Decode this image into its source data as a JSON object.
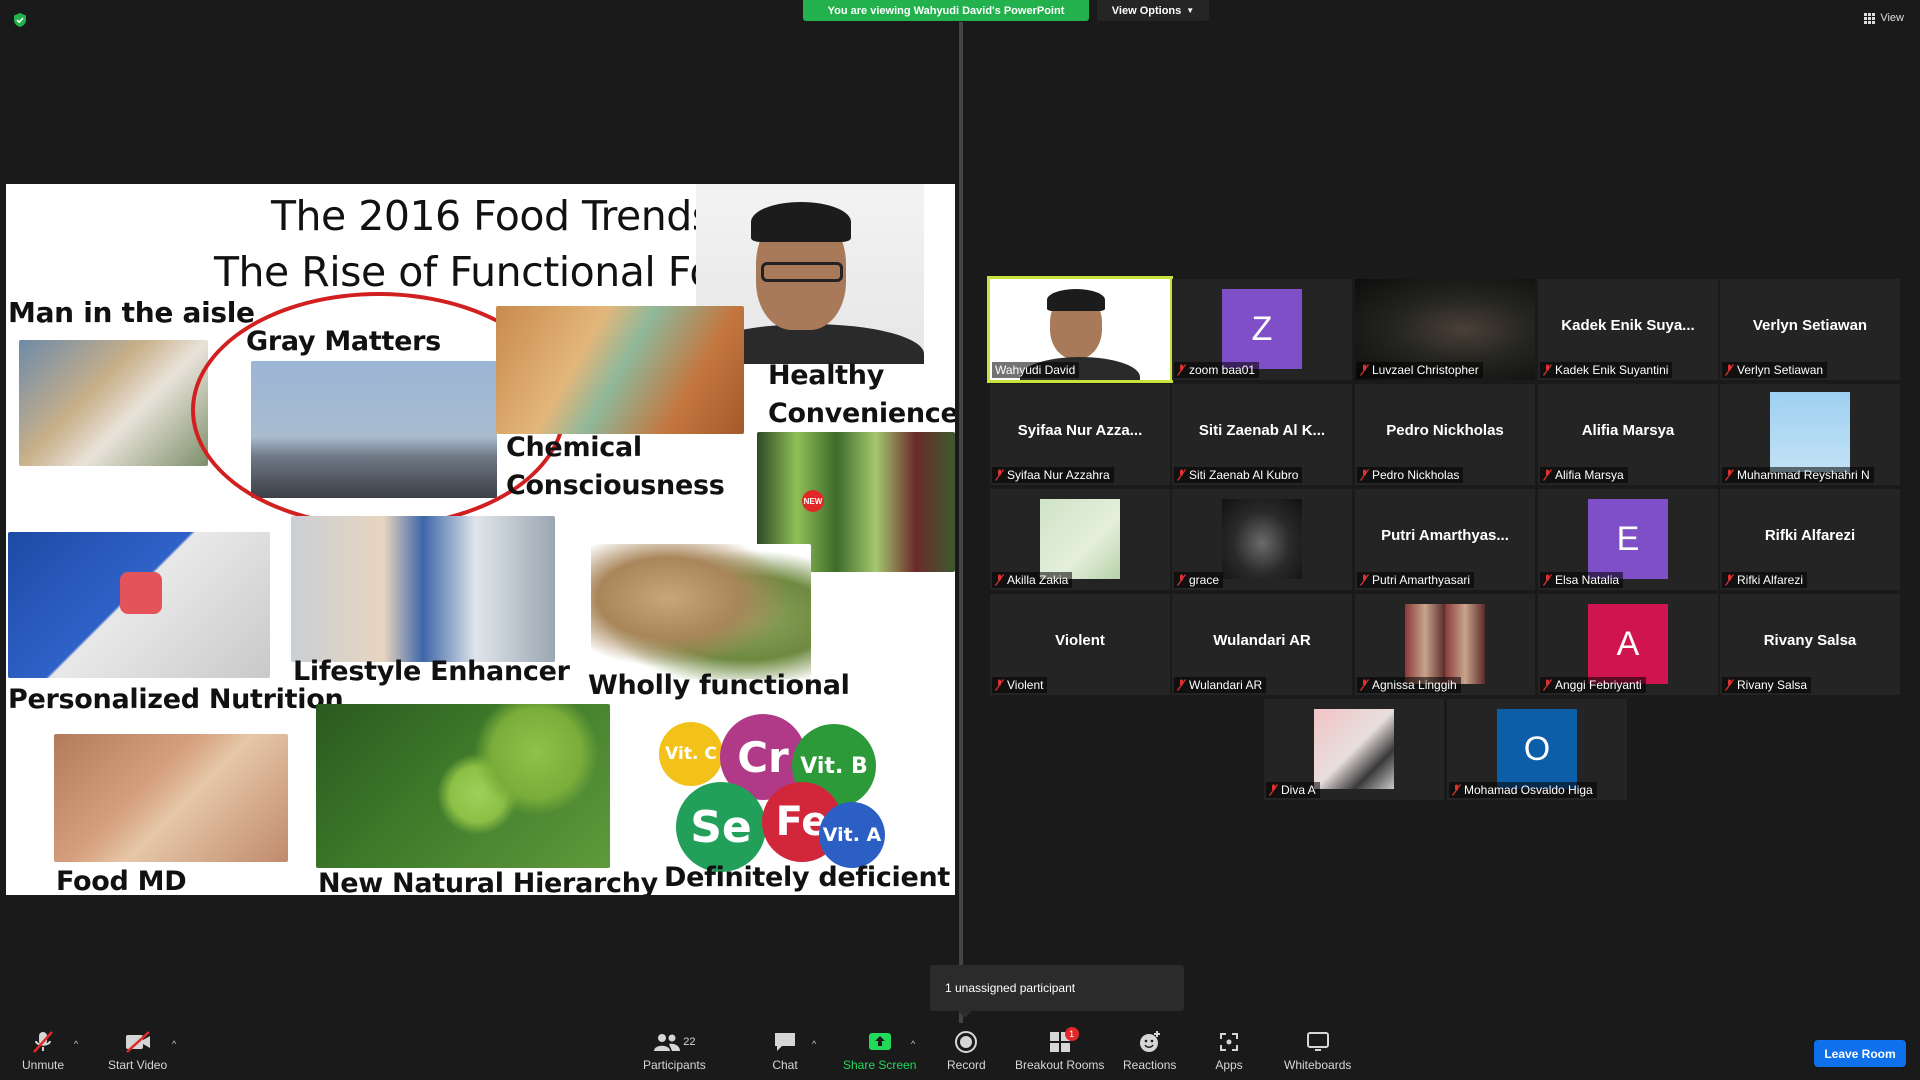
{
  "top": {
    "banner": "You are viewing Wahyudi David's PowerPoint",
    "view_options": "View Options",
    "view": "View"
  },
  "slide": {
    "title": "The 2016 Food Trends",
    "subtitle": "The Rise of Functional Food",
    "labels": {
      "man_aisle": "Man in the aisle",
      "gray_matters": "Gray Matters",
      "healthy_1": "Healthy",
      "healthy_2": "Convenience",
      "chem_1": "Chemical",
      "chem_2": "Consciousness",
      "personalized": "Personalized Nutrition",
      "lifestyle": "Lifestyle Enhancer",
      "wholly": "Wholly functional",
      "food_md": "Food MD",
      "natural": "New Natural Hierarchy",
      "deficient": "Definitely deficient"
    },
    "vitamins": {
      "vc": "Vit. C",
      "cr": "Cr",
      "vb": "Vit. B",
      "se": "Se",
      "fe": "Fe",
      "va": "Vit. A"
    },
    "new_badge": "NEW"
  },
  "gallery": [
    {
      "name": "Wahyudi David",
      "big": "",
      "type": "presenter"
    },
    {
      "name": "zoom baa01",
      "big": "",
      "type": "avatar",
      "letter": "Z",
      "color": "#7e4fc7"
    },
    {
      "name": "Luvzael Christopher",
      "big": "",
      "type": "dark"
    },
    {
      "name": "Kadek Enik Suyantini",
      "big": "Kadek  Enik  Suya...",
      "type": "text"
    },
    {
      "name": "Verlyn Setiawan",
      "big": "Verlyn Setiawan",
      "type": "text"
    },
    {
      "name": "Syifaa Nur Azzahra",
      "big": "Syifaa  Nur  Azza...",
      "type": "text"
    },
    {
      "name": "Siti Zaenab Al Kubro",
      "big": "Siti  Zaenab  Al  K...",
      "type": "text"
    },
    {
      "name": "Pedro Nickholas",
      "big": "Pedro Nickholas",
      "type": "text"
    },
    {
      "name": "Alifia Marsya",
      "big": "Alifia Marsya",
      "type": "text"
    },
    {
      "name": "Muhammad Reyshahri N",
      "big": "",
      "type": "sky"
    },
    {
      "name": "Akilla Zakia",
      "big": "",
      "type": "greenpic"
    },
    {
      "name": "grace",
      "big": "",
      "type": "bwpic"
    },
    {
      "name": "Putri Amarthyasari",
      "big": "Putri  Amarthyas...",
      "type": "text"
    },
    {
      "name": "Elsa Natalia",
      "big": "",
      "type": "avatar",
      "letter": "E",
      "color": "#7e4fc7"
    },
    {
      "name": "Rifki Alfarezi",
      "big": "Rifki Alfarezi",
      "type": "text"
    },
    {
      "name": "Violent",
      "big": "Violent",
      "type": "text"
    },
    {
      "name": "Wulandari AR",
      "big": "Wulandari AR",
      "type": "text"
    },
    {
      "name": "Agnissa Linggih",
      "big": "",
      "type": "collage"
    },
    {
      "name": "Anggi Febriyanti",
      "big": "",
      "type": "avatar",
      "letter": "A",
      "color": "#d0144f"
    },
    {
      "name": "Rivany Salsa",
      "big": "Rivany Salsa",
      "type": "text"
    },
    {
      "name": "Diva A",
      "big": "",
      "type": "pinkpic"
    },
    {
      "name": "Mohamad Osvaldo Higa",
      "big": "",
      "type": "avatar",
      "letter": "O",
      "color": "#0c5ea8"
    }
  ],
  "tooltip": "1 unassigned participant",
  "toolbar": {
    "unmute": "Unmute",
    "start_video": "Start Video",
    "participants": "Participants",
    "participants_count": "22",
    "chat": "Chat",
    "share_screen": "Share Screen",
    "record": "Record",
    "breakout": "Breakout Rooms",
    "breakout_badge": "1",
    "reactions": "Reactions",
    "apps": "Apps",
    "whiteboards": "Whiteboards",
    "leave": "Leave Room"
  }
}
